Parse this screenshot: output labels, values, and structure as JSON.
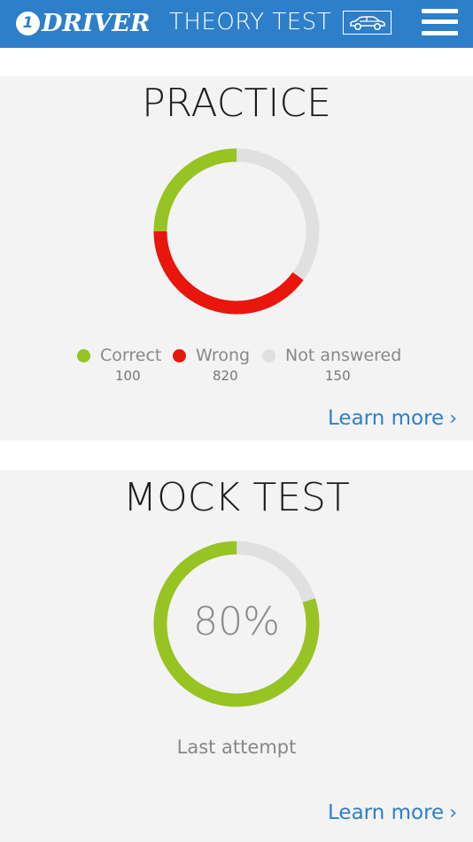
{
  "header": {
    "logo_one": "1",
    "logo_word": "DRIVER",
    "title": "THEORY TEST",
    "car_icon": "car-icon",
    "menu_icon": "hamburger-menu-icon"
  },
  "practice": {
    "title": "PRACTICE",
    "legend": [
      {
        "label": "Correct",
        "count": "100",
        "color": "#97c323"
      },
      {
        "label": "Wrong",
        "count": "820",
        "color": "#e8160c"
      },
      {
        "label": "Not answered",
        "count": "150",
        "color": "#e0e0e0"
      }
    ],
    "ring_fractions": {
      "correct": 0.25,
      "wrong": 0.4,
      "not_answered": 0.35
    },
    "learn_more": "Learn more"
  },
  "mock": {
    "title": "MOCK TEST",
    "percent": "80%",
    "percent_value": 0.8,
    "subtitle": "Last attempt",
    "learn_more": "Learn more",
    "ring_color": "#97c323",
    "track_color": "#e0e0e0"
  },
  "colors": {
    "brand": "#2e7fca",
    "card_bg": "#f3f3f3"
  }
}
